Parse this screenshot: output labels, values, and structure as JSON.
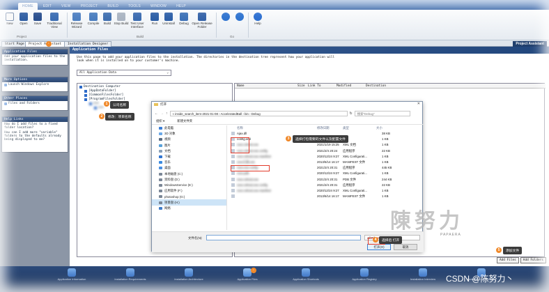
{
  "menubar": [
    "HOME",
    "EDIT",
    "VIEW",
    "PROJECT",
    "BUILD",
    "TOOLS",
    "WINDOW",
    "HELP"
  ],
  "ribbon": {
    "buttons": [
      "New",
      "Open",
      "Save",
      "Traditional View",
      "Release Wizard",
      "Compile",
      "Build",
      "Stop Build",
      "Test User Interface",
      "Run",
      "Uninstall",
      "Debug",
      "Open Release Folder",
      "",
      "",
      "Help"
    ],
    "groups": [
      "Project",
      "Build",
      "Go"
    ]
  },
  "tabs": [
    "Start Page",
    "Project Assistant",
    "Installation Designer"
  ],
  "title_strip": "Project Assistant",
  "left_panel": {
    "app_files": {
      "title": "Application Files",
      "text": "Add your application files to the installation."
    },
    "more_options": {
      "title": "More Options",
      "items": [
        "Launch Windows Explore"
      ]
    },
    "other_places": {
      "title": "Other Places",
      "items": [
        "Files and Folders"
      ]
    },
    "help_links": {
      "title": "Help Links",
      "items": [
        "How do I add files to a fixed folder location?",
        "How can I add more \"variable\" folders to the defaults already being displayed to me?"
      ]
    }
  },
  "main": {
    "banner": "Application Files",
    "description": "Use this page to add your application files to the installation. The directories in the destination tree represent how your application will look when it is installed on to your customer's machine.",
    "combo": "All Application Data",
    "tree": [
      "Destination Computer",
      "[AppDataFolder]",
      "[CommonFilesFolder]",
      "[ProgramFilesFolder]",
      "xxx",
      "xxx"
    ],
    "list_headers": [
      "Name",
      "Size",
      "Link To",
      "Modified",
      "Destination"
    ],
    "add_buttons": [
      "Add Files",
      "Add Folders"
    ]
  },
  "dialog": {
    "title": "打开",
    "path": [
      "« inside_search_item-2021-01-08",
      "AcceleratedBall",
      "bin",
      "Debug"
    ],
    "search_placeholder": "搜索\"Debug\"",
    "toolbar": [
      "组织 ▾",
      "新建文件夹"
    ],
    "nav": [
      "此电脑",
      "3D 对象",
      "视频",
      "图片",
      "文档",
      "下载",
      "音乐",
      "桌面",
      "本地磁盘 (C:)",
      "资料盘 (D:)",
      "WindowsService (E:)",
      "应用软件 (F:)",
      "photoshop (G:)",
      "项目盘 (H:)",
      "网络"
    ],
    "headers": [
      "名称",
      "修改日期",
      "类型",
      "大小"
    ],
    "files": [
      {
        "name": "Ajax.dll",
        "date": "",
        "type": "",
        "size": "38 KB"
      },
      {
        "name": "config.xml",
        "date": "",
        "type": "",
        "size": "1 KB"
      },
      {
        "name": "xxxx.vshost.exe",
        "date": "2021/1/19 15:25",
        "type": "XML 文档",
        "size": "1 KB"
      },
      {
        "name": "xxxx.vshost.exe.config",
        "date": "2021/2/4 20:24",
        "type": "应用程序",
        "size": "22 KB"
      },
      {
        "name": "xxxx.vshost.exe.manifest",
        "date": "2020/12/24 9:27",
        "type": "XML Configurati...",
        "size": "1 KB"
      },
      {
        "name": "xxxx工具.exe",
        "date": "2013/6/14 16:17",
        "type": "MANIFEST 文件",
        "size": "1 KB"
      },
      {
        "name": "xxxx.exe.config",
        "date": "2021/2/4 20:31",
        "type": "应用程序",
        "size": "445 KB"
      },
      {
        "name": "xxxx.pdb",
        "date": "2020/12/24 9:27",
        "type": "XML Configurati...",
        "size": "1 KB"
      },
      {
        "name": "xxxx.vshost.exe",
        "date": "2021/2/4 20:31",
        "type": "PDB 文件",
        "size": "244 KB"
      },
      {
        "name": "xxxx.vshost.exe.config",
        "date": "2021/2/4 20:31",
        "type": "应用程序",
        "size": "22 KB"
      },
      {
        "name": "xxxx.vshost.exe.manifest",
        "date": "2020/12/24 9:27",
        "type": "XML Configurati...",
        "size": "1 KB"
      },
      {
        "name": "",
        "date": "2013/6/14 16:17",
        "type": "MANIFEST 文件",
        "size": "1 KB"
      }
    ],
    "filename_label": "文件名(N):",
    "filetype": "All Files",
    "open": "打开(O)",
    "cancel": "取消"
  },
  "annotations": [
    {
      "num": "1",
      "text": "公司名称"
    },
    {
      "num": "2",
      "text": "修改：项目名称"
    },
    {
      "num": "3",
      "text": "选择打包需要的文件以及配置文件"
    },
    {
      "num": "4",
      "text": "选择后 打开"
    },
    {
      "num": "5",
      "text": "添加文件"
    }
  ],
  "bottom_nav": [
    "Application Information",
    "Installation Requirements",
    "Installation Architecture",
    "Application Files",
    "Application Shortcuts",
    "Application Registry",
    "Installation Interview",
    "Installation Localization"
  ],
  "watermark": "陳努力",
  "watermark_sub": "PAPAERA",
  "csdn": "CSDN @陈努力丶",
  "colors": {
    "accent": "#2a5aa0",
    "badge": "#f0892a",
    "highlight": "#e23b2b"
  }
}
